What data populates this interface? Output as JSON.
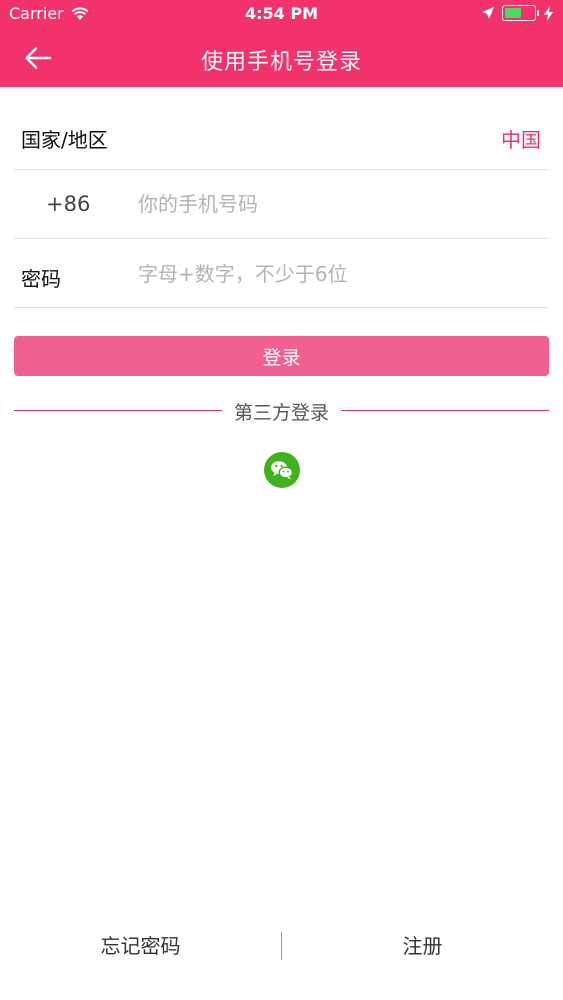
{
  "status_bar": {
    "carrier": "Carrier",
    "time": "4:54 PM",
    "icons": [
      "wifi-icon",
      "location-arrow-icon",
      "battery-icon",
      "charging-bolt-icon"
    ]
  },
  "nav": {
    "title": "使用手机号登录",
    "back_icon": "back-arrow-icon"
  },
  "form": {
    "country": {
      "label": "国家/地区",
      "value": "中国"
    },
    "phone": {
      "prefix": "+86",
      "value": "",
      "placeholder": "你的手机号码"
    },
    "password": {
      "label": "密码",
      "value": "",
      "placeholder": "字母+数字，不少于6位"
    },
    "login_label": "登录"
  },
  "third_party": {
    "label": "第三方登录",
    "providers": [
      {
        "icon": "wechat-icon"
      }
    ]
  },
  "footer": {
    "forgot_label": "忘记密码",
    "register_label": "注册"
  },
  "colors": {
    "brand": "#f2336b",
    "login_button": "#f06190",
    "accent_text": "#e8336e",
    "wechat": "#3fb21e",
    "battery": "#4cd964"
  }
}
